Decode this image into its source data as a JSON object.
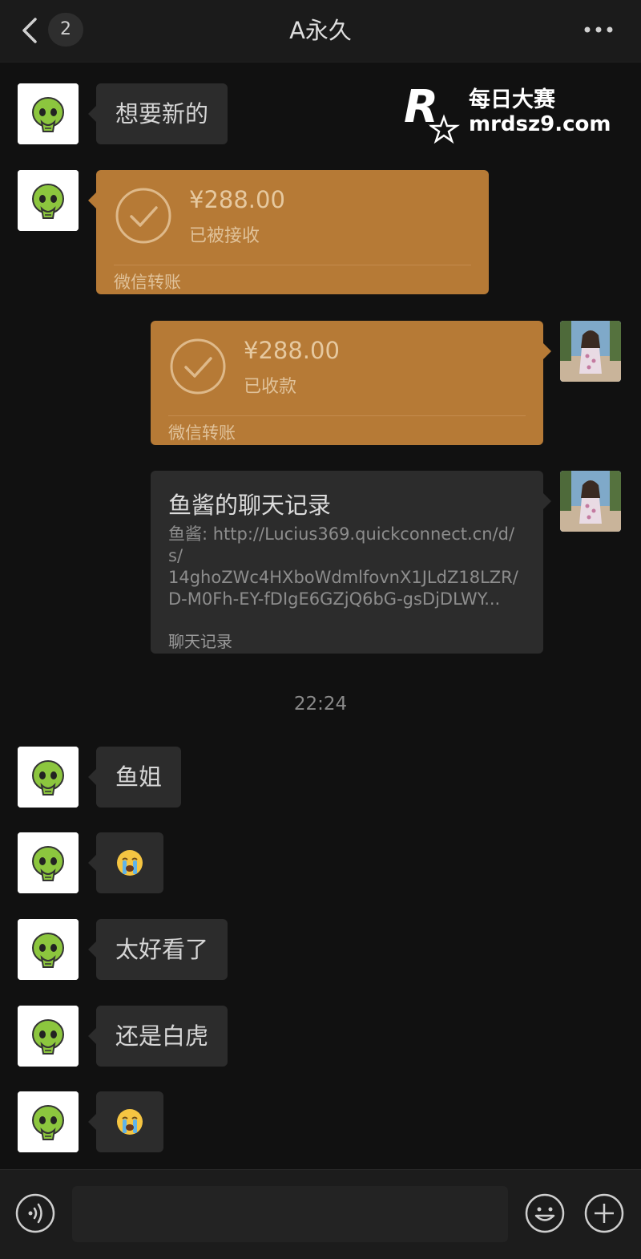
{
  "header": {
    "badge_count": "2",
    "title": "A永久"
  },
  "watermark": {
    "line1": "每日大赛",
    "line2": "mrdsz9.com",
    "logo_text": "每日大赛"
  },
  "messages": {
    "m1": "想要新的",
    "transfer1": {
      "amount": "¥288.00",
      "status": "已被接收",
      "footer": "微信转账"
    },
    "transfer2": {
      "amount": "¥288.00",
      "status": "已收款",
      "footer": "微信转账"
    },
    "record": {
      "title": "鱼酱的聊天记录",
      "line1": "鱼酱: http://Lucius369.quickconnect.cn/d/",
      "line2": "s/",
      "line3": "14ghoZWc4HXboWdmlfovnX1JLdZ18LZR/",
      "line4": "D-M0Fh-EY-fDIgE6GZjQ6bG-gsDjDLWY...",
      "footer": "聊天记录"
    },
    "timestamp": "22:24",
    "m2": "鱼姐",
    "m3_emoji": "crying-face",
    "m4": "太好看了",
    "m5": "还是白虎",
    "m6_emoji": "crying-face"
  },
  "colors": {
    "background": "#111111",
    "bubble": "#2c2c2c",
    "transfer": "#b67a36"
  }
}
